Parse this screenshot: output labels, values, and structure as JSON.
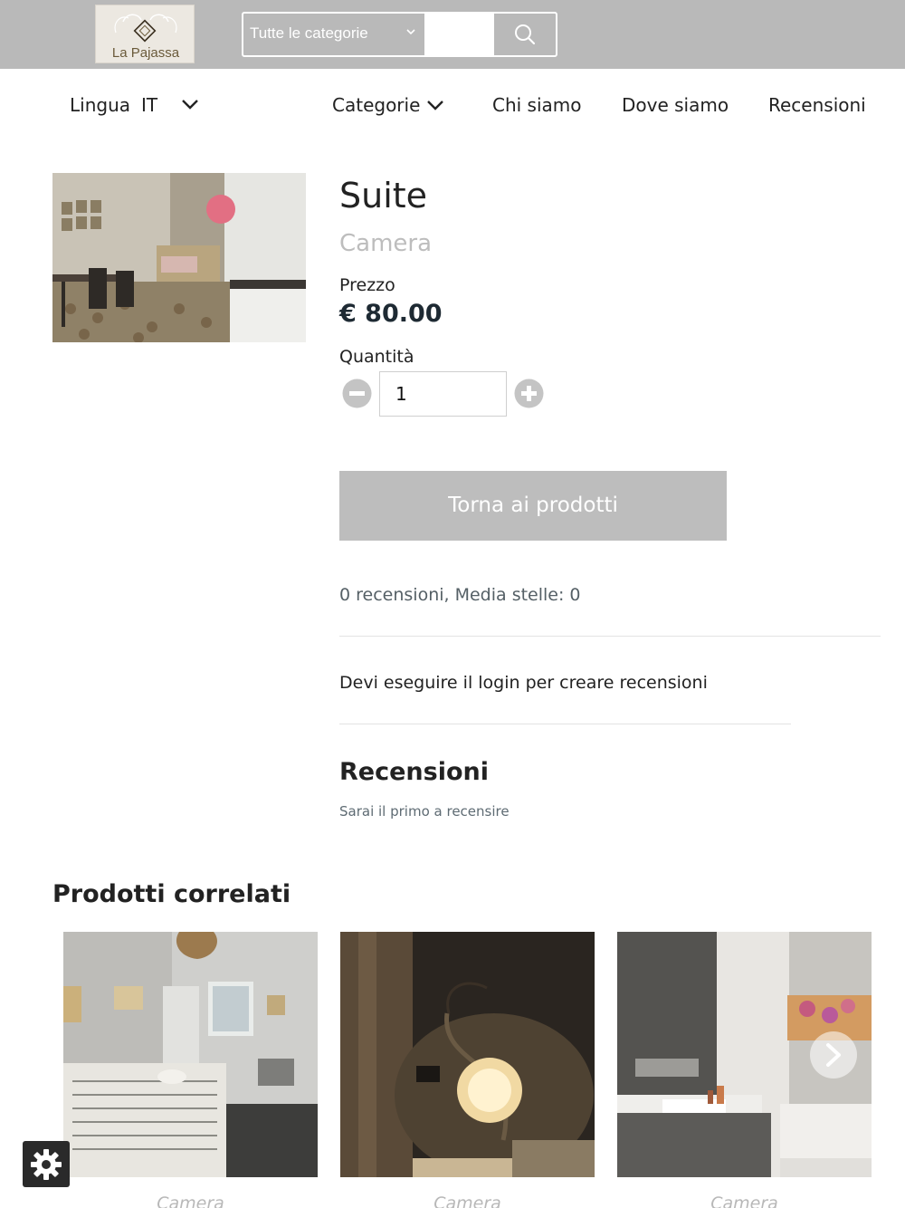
{
  "header": {
    "logo_text": "La Pajassa",
    "search": {
      "category_select": "Tutte le categorie",
      "input_placeholder": "",
      "icon": "search-icon"
    }
  },
  "nav": {
    "language_label": "Lingua",
    "language_value": "IT",
    "items": [
      {
        "label": "Categorie",
        "has_dropdown": true
      },
      {
        "label": "Chi siamo"
      },
      {
        "label": "Dove siamo"
      },
      {
        "label": "Recensioni"
      }
    ]
  },
  "product": {
    "title": "Suite",
    "category": "Camera",
    "price_label": "Prezzo",
    "price": "€ 80.00",
    "quantity_label": "Quantità",
    "quantity": "1",
    "back_button": "Torna ai prodotti"
  },
  "reviews": {
    "summary": "0 recensioni, Media stelle: 0",
    "login_note": "Devi eseguire il login per creare recensioni",
    "heading": "Recensioni",
    "empty": "Sarai il primo a recensire"
  },
  "related": {
    "heading": "Prodotti correlati",
    "items": [
      {
        "category": "Camera"
      },
      {
        "category": "Camera"
      },
      {
        "category": "Camera"
      }
    ]
  },
  "colors": {
    "topbar": "#b9b9b9",
    "button_bg": "#bdbdbd",
    "muted_text": "#bdbdbd"
  }
}
